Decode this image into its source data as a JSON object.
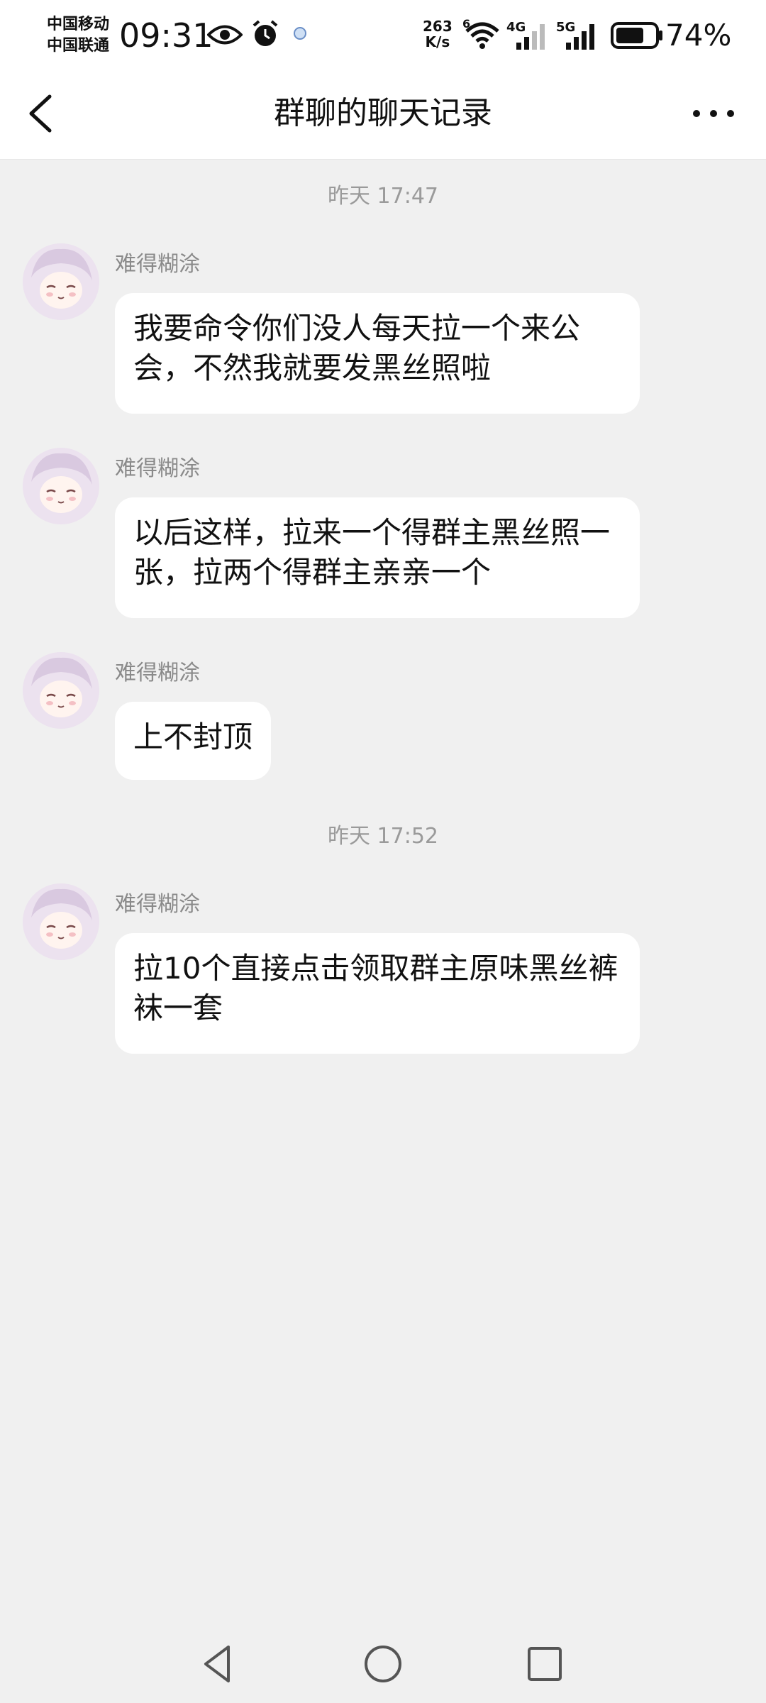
{
  "status_bar": {
    "carrier1": "中国移动",
    "carrier2": "中国联通",
    "time": "09:31",
    "net_speed_value": "263",
    "net_speed_unit": "K/s",
    "wifi_label": "6",
    "signal1_label": "4G",
    "signal2_label": "5G",
    "battery_level": 0.74,
    "battery_text": "74%",
    "icons": [
      "eye-icon",
      "alarm-icon",
      "notification-icon",
      "wifi-icon",
      "signal-icon",
      "battery-icon"
    ]
  },
  "header": {
    "title": "群聊的聊天记录",
    "back_icon": "chevron-left-icon",
    "more_icon": "more-horizontal-icon"
  },
  "chat": {
    "messages": [
      {
        "type": "time",
        "text": "昨天 17:47"
      },
      {
        "type": "msg",
        "sender": "难得糊涂",
        "text": "我要命令你们没人每天拉一个来公会，不然我就要发黑丝照啦"
      },
      {
        "type": "msg",
        "sender": "难得糊涂",
        "text": "以后这样，拉来一个得群主黑丝照一张，拉两个得群主亲亲一个"
      },
      {
        "type": "msg",
        "sender": "难得糊涂",
        "text": "上不封顶"
      },
      {
        "type": "time",
        "text": "昨天 17:52"
      },
      {
        "type": "msg",
        "sender": "难得糊涂",
        "text": "拉10个直接点击领取群主原味黑丝裤袜一套"
      }
    ]
  },
  "navbar": {
    "icons": [
      "back-triangle-icon",
      "home-circle-icon",
      "recents-square-icon"
    ]
  },
  "colors": {
    "background": "#f0f0f0",
    "bubble": "#ffffff",
    "meta_text": "#9a9a9a"
  }
}
